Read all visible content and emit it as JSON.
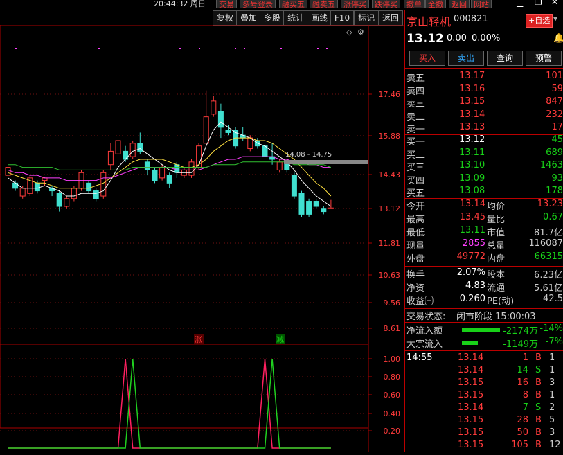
{
  "topbar": {
    "time": "20:44:32  周日",
    "buttons": [
      "交易",
      "多号登录",
      "融买五",
      "融卖五",
      "涨停买",
      "跌停买",
      "撤单",
      "全撤",
      "返回",
      "网站"
    ]
  },
  "toolbar": {
    "buttons": [
      "复权",
      "叠加",
      "多股",
      "统计",
      "画线",
      "F10",
      "标记",
      "返回"
    ],
    "icons": [
      "diamond-icon",
      "settings-icon"
    ]
  },
  "stock": {
    "name": "京山轻机",
    "code": "000821",
    "add_watch": "+自选",
    "price": "13.12",
    "change": "0.00",
    "change_pct": "0.00%"
  },
  "actions": {
    "buy": "买入",
    "sell": "卖出",
    "query": "查询",
    "alert": "预警"
  },
  "orderbook": {
    "asks": [
      {
        "label": "卖五",
        "price": "13.17",
        "vol": "101"
      },
      {
        "label": "卖四",
        "price": "13.16",
        "vol": "59"
      },
      {
        "label": "卖三",
        "price": "13.15",
        "vol": "847"
      },
      {
        "label": "卖二",
        "price": "13.14",
        "vol": "232"
      },
      {
        "label": "卖一",
        "price": "13.13",
        "vol": "17"
      }
    ],
    "bids": [
      {
        "label": "买一",
        "price": "13.12",
        "vol": "45"
      },
      {
        "label": "买二",
        "price": "13.11",
        "vol": "689"
      },
      {
        "label": "买三",
        "price": "13.10",
        "vol": "1463"
      },
      {
        "label": "买四",
        "price": "13.09",
        "vol": "93"
      },
      {
        "label": "买五",
        "price": "13.08",
        "vol": "178"
      }
    ]
  },
  "stats": [
    {
      "l1": "今开",
      "v1": "13.14",
      "l2": "均价",
      "v2": "13.23"
    },
    {
      "l1": "最高",
      "v1": "13.45",
      "l2": "量比",
      "v2": "0.67"
    },
    {
      "l1": "最低",
      "v1": "13.11",
      "l2": "市值",
      "v2": "81.7亿"
    },
    {
      "l1": "现量",
      "v1": "2855",
      "l2": "总量",
      "v2": "116087"
    },
    {
      "l1": "外盘",
      "v1": "49772",
      "l2": "内盘",
      "v2": "66315"
    }
  ],
  "stats2": [
    {
      "l1": "换手",
      "v1": "2.07%",
      "l2": "股本",
      "v2": "6.23亿"
    },
    {
      "l1": "净资",
      "v1": "4.83",
      "l2": "流通",
      "v2": "5.61亿"
    },
    {
      "l1": "收益㈢",
      "v1": "0.260",
      "l2": "PE(动)",
      "v2": "42.5"
    }
  ],
  "status": {
    "label": "交易状态:",
    "value": "闭市阶段 15:00:03"
  },
  "flows": [
    {
      "label": "净流入额",
      "value": "-2174万",
      "pct": "-14%",
      "bar": 0.55
    },
    {
      "label": "大宗流入",
      "value": "-1149万",
      "pct": "-7%",
      "bar": 0.23
    }
  ],
  "ticks": [
    {
      "time": "14:55",
      "price": "13.14",
      "vol": "1",
      "side": "B",
      "n": "1"
    },
    {
      "time": "",
      "price": "13.14",
      "vol": "14",
      "side": "S",
      "n": "1"
    },
    {
      "time": "",
      "price": "13.15",
      "vol": "16",
      "side": "B",
      "n": "3"
    },
    {
      "time": "",
      "price": "13.15",
      "vol": "8",
      "side": "B",
      "n": "1"
    },
    {
      "time": "",
      "price": "13.14",
      "vol": "7",
      "side": "S",
      "n": "2"
    },
    {
      "time": "",
      "price": "13.15",
      "vol": "28",
      "side": "B",
      "n": "5"
    },
    {
      "time": "",
      "price": "13.15",
      "vol": "50",
      "side": "B",
      "n": "3"
    },
    {
      "time": "",
      "price": "13.15",
      "vol": "105",
      "side": "B",
      "n": "12"
    }
  ],
  "chart_data": {
    "type": "candlestick",
    "price_axis": {
      "ticks": [
        "17.46",
        "15.88",
        "14.43",
        "13.12",
        "11.81",
        "10.63",
        "9.56",
        "8.61"
      ]
    },
    "range_label": "14.08 - 14.75",
    "markers": {
      "up": "涨",
      "down": "减"
    },
    "candles": [
      {
        "o": 14.4,
        "c": 14.7,
        "h": 14.8,
        "l": 14.2
      },
      {
        "o": 14.1,
        "c": 13.9,
        "h": 14.2,
        "l": 13.8
      },
      {
        "o": 13.6,
        "c": 13.9,
        "h": 14.0,
        "l": 13.5
      },
      {
        "o": 13.7,
        "c": 14.3,
        "h": 14.4,
        "l": 13.6
      },
      {
        "o": 14.1,
        "c": 13.8,
        "h": 14.2,
        "l": 13.7
      },
      {
        "o": 14.2,
        "c": 14.3,
        "h": 14.35,
        "l": 14.0
      },
      {
        "o": 13.9,
        "c": 13.8,
        "h": 14.0,
        "l": 13.6
      },
      {
        "o": 13.7,
        "c": 13.2,
        "h": 13.8,
        "l": 13.0
      },
      {
        "o": 13.2,
        "c": 13.5,
        "h": 13.6,
        "l": 13.1
      },
      {
        "o": 13.5,
        "c": 13.9,
        "h": 14.0,
        "l": 13.4
      },
      {
        "o": 13.9,
        "c": 14.5,
        "h": 14.6,
        "l": 13.8
      },
      {
        "o": 14.1,
        "c": 13.8,
        "h": 14.2,
        "l": 13.7
      },
      {
        "o": 13.8,
        "c": 13.5,
        "h": 13.9,
        "l": 13.4
      },
      {
        "o": 13.6,
        "c": 14.5,
        "h": 14.6,
        "l": 13.5
      },
      {
        "o": 14.8,
        "c": 15.3,
        "h": 15.6,
        "l": 14.6
      },
      {
        "o": 15.2,
        "c": 15.7,
        "h": 15.8,
        "l": 15.0
      },
      {
        "o": 15.3,
        "c": 15.0,
        "h": 15.5,
        "l": 14.9
      },
      {
        "o": 15.1,
        "c": 15.6,
        "h": 15.7,
        "l": 15.0
      },
      {
        "o": 15.6,
        "c": 15.3,
        "h": 16.0,
        "l": 15.2
      },
      {
        "o": 14.9,
        "c": 14.6,
        "h": 15.0,
        "l": 14.4
      },
      {
        "o": 14.6,
        "c": 14.2,
        "h": 14.7,
        "l": 14.1
      },
      {
        "o": 14.3,
        "c": 14.7,
        "h": 14.8,
        "l": 14.2
      },
      {
        "o": 14.4,
        "c": 14.1,
        "h": 14.5,
        "l": 13.9
      },
      {
        "o": 14.8,
        "c": 14.5,
        "h": 14.9,
        "l": 14.3
      },
      {
        "o": 14.4,
        "c": 14.6,
        "h": 14.7,
        "l": 14.3
      },
      {
        "o": 14.4,
        "c": 14.9,
        "h": 15.0,
        "l": 14.3
      },
      {
        "o": 14.7,
        "c": 15.5,
        "h": 15.6,
        "l": 14.6
      },
      {
        "o": 15.6,
        "c": 16.6,
        "h": 17.6,
        "l": 15.5
      },
      {
        "o": 16.7,
        "c": 17.2,
        "h": 17.4,
        "l": 16.6
      },
      {
        "o": 16.8,
        "c": 16.2,
        "h": 17.1,
        "l": 15.8
      },
      {
        "o": 16.1,
        "c": 16.0,
        "h": 16.3,
        "l": 15.9
      },
      {
        "o": 16.1,
        "c": 15.5,
        "h": 16.2,
        "l": 15.4
      },
      {
        "o": 15.9,
        "c": 15.8,
        "h": 16.2,
        "l": 15.7
      },
      {
        "o": 15.4,
        "c": 15.8,
        "h": 15.9,
        "l": 15.3
      },
      {
        "o": 15.7,
        "c": 15.5,
        "h": 15.8,
        "l": 15.4
      },
      {
        "o": 15.5,
        "c": 15.1,
        "h": 15.6,
        "l": 15.0
      },
      {
        "o": 15.1,
        "c": 15.0,
        "h": 15.6,
        "l": 14.8
      },
      {
        "o": 14.6,
        "c": 14.9,
        "h": 15.0,
        "l": 14.5
      },
      {
        "o": 14.9,
        "c": 14.6,
        "h": 15.0,
        "l": 14.5
      },
      {
        "o": 14.4,
        "c": 13.6,
        "h": 14.5,
        "l": 13.5
      },
      {
        "o": 13.7,
        "c": 12.9,
        "h": 13.8,
        "l": 12.8
      },
      {
        "o": 13.4,
        "c": 12.9,
        "h": 13.5,
        "l": 12.8
      },
      {
        "o": 13.4,
        "c": 13.2,
        "h": 13.5,
        "l": 13.1
      },
      {
        "o": 13.1,
        "c": 13.0,
        "h": 13.2,
        "l": 12.9
      },
      {
        "o": 13.12,
        "c": 13.14,
        "h": 13.45,
        "l": 13.11
      }
    ],
    "ma_lines": [
      {
        "name": "ma1",
        "color": "#ffffff",
        "values": [
          14.3,
          14.1,
          13.9,
          13.9,
          13.9,
          14.0,
          13.9,
          13.8,
          13.6,
          13.6,
          13.7,
          13.7,
          13.7,
          13.8,
          14.2,
          14.7,
          15.0,
          15.3,
          15.4,
          15.2,
          15.0,
          14.8,
          14.6,
          14.5,
          14.5,
          14.5,
          14.8,
          15.5,
          16.1,
          16.4,
          16.2,
          16.0,
          15.9,
          15.8,
          15.6,
          15.5,
          15.3,
          15.1,
          14.9,
          14.6,
          14.2,
          13.9,
          13.6,
          13.4,
          13.2
        ]
      },
      {
        "name": "ma2",
        "color": "#ffe040",
        "values": [
          14.5,
          14.4,
          14.3,
          14.2,
          14.1,
          14.1,
          14.0,
          13.9,
          13.9,
          13.9,
          13.9,
          13.9,
          14.0,
          14.1,
          14.3,
          14.5,
          14.7,
          14.9,
          15.0,
          15.0,
          15.0,
          15.0,
          14.9,
          14.8,
          14.7,
          14.7,
          14.8,
          15.0,
          15.3,
          15.5,
          15.7,
          15.8,
          15.8,
          15.8,
          15.7,
          15.7,
          15.6,
          15.4,
          15.2,
          15.0,
          14.7,
          14.4,
          14.1,
          13.9,
          13.6
        ]
      },
      {
        "name": "ma3",
        "color": "#ff40ff",
        "values": [
          14.6,
          14.5,
          14.5,
          14.4,
          14.4,
          14.3,
          14.3,
          14.3,
          14.2,
          14.2,
          14.2,
          14.2,
          14.2,
          14.3,
          14.3,
          14.4,
          14.5,
          14.6,
          14.7,
          14.7,
          14.7,
          14.7,
          14.7,
          14.6,
          14.6,
          14.6,
          14.6,
          14.7,
          14.8,
          14.9,
          15.0,
          15.0,
          15.1,
          15.1,
          15.1,
          15.1,
          15.1,
          15.0,
          15.0,
          14.9,
          14.9,
          14.8,
          14.8,
          14.7,
          14.7
        ]
      },
      {
        "name": "ma4",
        "color": "#30c030",
        "values": [
          14.8,
          14.8,
          14.7,
          14.7,
          14.7,
          14.7,
          14.7,
          14.6,
          14.6,
          14.6,
          14.6,
          14.6,
          14.6,
          14.6,
          14.6,
          14.6,
          14.6,
          14.7,
          14.7,
          14.7,
          14.7,
          14.7,
          14.7,
          14.7,
          14.7,
          14.7,
          14.7,
          14.7,
          14.8,
          14.8,
          14.8,
          14.8,
          14.9,
          14.9,
          14.9,
          14.9,
          14.9,
          14.9,
          14.9,
          14.8,
          14.8,
          14.8,
          14.8,
          14.8,
          14.7
        ]
      }
    ],
    "indicator": {
      "axis_ticks": [
        "1.00",
        "0.80",
        "0.60",
        "0.40",
        "0.20"
      ],
      "series": [
        {
          "name": "s1",
          "color": "#ff2060",
          "peaks": [
            16,
            35
          ]
        },
        {
          "name": "s2",
          "color": "#20d020",
          "peaks": [
            17,
            36
          ]
        }
      ]
    }
  }
}
